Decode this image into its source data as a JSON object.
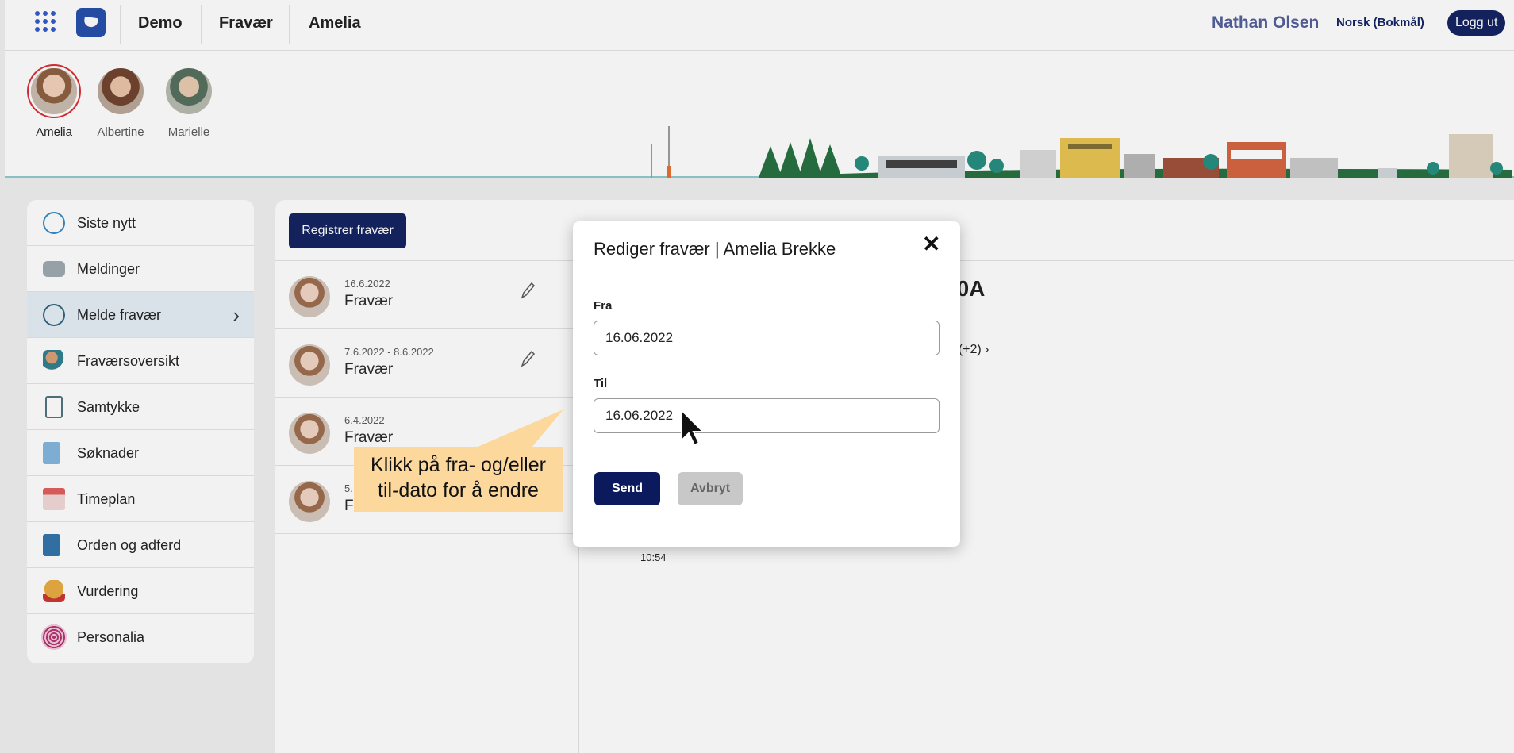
{
  "topbar": {
    "crumbs": [
      "Demo",
      "Fravær",
      "Amelia"
    ],
    "user_name": "Nathan Olsen",
    "language": "Norsk (Bokmål)",
    "logout_label": "Logg ut"
  },
  "children": [
    {
      "name": "Amelia",
      "active": true
    },
    {
      "name": "Albertine",
      "active": false
    },
    {
      "name": "Marielle",
      "active": false
    }
  ],
  "sidebar": {
    "items": [
      {
        "label": "Siste nytt",
        "icon": "news-icon"
      },
      {
        "label": "Meldinger",
        "icon": "envelope-icon"
      },
      {
        "label": "Melde fravær",
        "icon": "clock-icon",
        "active": true
      },
      {
        "label": "Fraværsoversikt",
        "icon": "absence-overview-icon"
      },
      {
        "label": "Samtykke",
        "icon": "clipboard-icon"
      },
      {
        "label": "Søknader",
        "icon": "application-search-icon"
      },
      {
        "label": "Timeplan",
        "icon": "calendar-icon"
      },
      {
        "label": "Orden og adferd",
        "icon": "conduct-icon"
      },
      {
        "label": "Vurdering",
        "icon": "medal-icon"
      },
      {
        "label": "Personalia",
        "icon": "fingerprint-icon"
      }
    ]
  },
  "main": {
    "register_button": "Registrer fravær",
    "absences": [
      {
        "date": "16.6.2022",
        "type": "Fravær"
      },
      {
        "date": "7.6.2022 - 8.6.2022",
        "type": "Fravær"
      },
      {
        "date": "6.4.2022",
        "type": "Fravær"
      },
      {
        "date": "5.",
        "type": "Fravær"
      }
    ],
    "detail_title": "10A",
    "detail_more": "n;  (+2) ›",
    "detail_time": "10:54"
  },
  "modal": {
    "title": "Rediger fravær | Amelia Brekke",
    "from_label": "Fra",
    "from_value": "16.06.2022",
    "to_label": "Til",
    "to_value": "16.06.2022",
    "send_label": "Send",
    "cancel_label": "Avbryt"
  },
  "callout": {
    "line1": "Klikk på fra- og/eller",
    "line2": "til-dato for å endre"
  },
  "colors": {
    "navy": "#0a1a5c",
    "callout": "#fcd89d",
    "active_ring": "#d9252b"
  }
}
